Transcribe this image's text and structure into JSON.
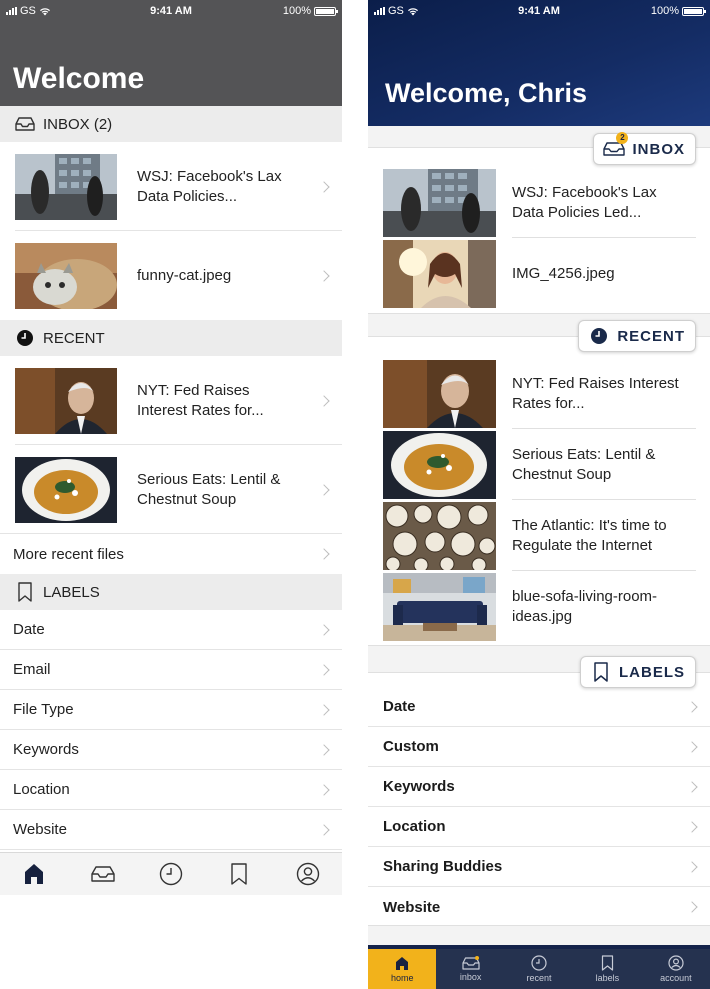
{
  "status": {
    "carrier": "GS",
    "time": "9:41 AM",
    "battery": "100%"
  },
  "screen_a": {
    "title": "Welcome",
    "sections": {
      "inbox": "INBOX (2)",
      "recent": "RECENT",
      "labels": "LABELS"
    },
    "inbox_items": [
      {
        "title": "WSJ: Facebook's Lax Data Policies...",
        "thumb": "building"
      },
      {
        "title": "funny-cat.jpeg",
        "thumb": "cat"
      }
    ],
    "recent_items": [
      {
        "title": "NYT: Fed Raises Interest Rates for...",
        "thumb": "portrait"
      },
      {
        "title": "Serious Eats: Lentil & Chestnut Soup",
        "thumb": "soup"
      }
    ],
    "more_recent": "More recent files",
    "labels": [
      "Date",
      "Email",
      "File Type",
      "Keywords",
      "Location",
      "Website"
    ],
    "tabbar": [
      "home-icon",
      "inbox-icon",
      "clock-icon",
      "bookmark-icon",
      "account-icon"
    ]
  },
  "screen_b": {
    "title": "Welcome, Chris",
    "pills": {
      "inbox": "INBOX",
      "inbox_badge": "2",
      "recent": "RECENT",
      "labels": "LABELS"
    },
    "inbox_items": [
      {
        "title": "WSJ: Facebook's Lax Data Policies Led...",
        "thumb": "building"
      },
      {
        "title": "IMG_4256.jpeg",
        "thumb": "selfie"
      }
    ],
    "recent_items": [
      {
        "title": "NYT: Fed Raises Interest Rates for...",
        "thumb": "portrait"
      },
      {
        "title": "Serious Eats: Lentil & Chestnut Soup",
        "thumb": "soup"
      },
      {
        "title": "The Atlantic: It's time to Regulate the Internet",
        "thumb": "clocks"
      },
      {
        "title": "blue-sofa-living-room-ideas.jpg",
        "thumb": "sofa"
      }
    ],
    "labels": [
      "Date",
      "Custom",
      "Keywords",
      "Location",
      "Sharing Buddies",
      "Website"
    ],
    "tabbar": [
      {
        "label": "home",
        "icon": "home-icon",
        "active": true
      },
      {
        "label": "inbox",
        "icon": "inbox-icon",
        "active": false
      },
      {
        "label": "recent",
        "icon": "clock-icon",
        "active": false
      },
      {
        "label": "labels",
        "icon": "bookmark-icon",
        "active": false
      },
      {
        "label": "account",
        "icon": "account-icon",
        "active": false
      }
    ]
  },
  "colors": {
    "header_gray": "#545456",
    "header_navy": "#142c64",
    "tab_active": "#f2b21b",
    "badge": "#f2b21b"
  }
}
